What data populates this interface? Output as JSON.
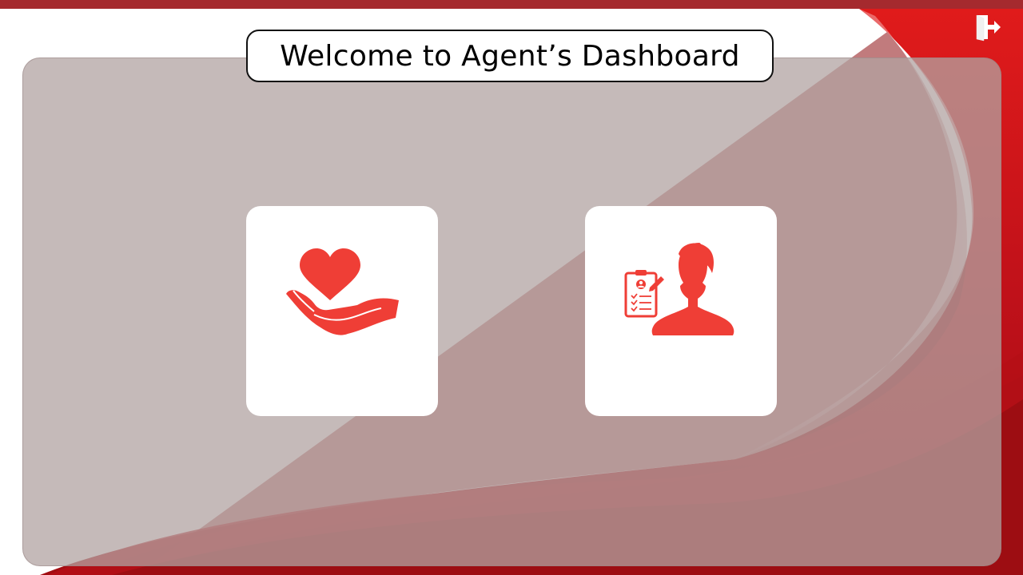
{
  "header": {
    "title": "Welcome to Agent’s Dashboard"
  },
  "toolbar": {
    "exit_icon": "door-exit-icon"
  },
  "cards": [
    {
      "icon": "hand-heart-icon"
    },
    {
      "icon": "agent-profile-clipboard-icon"
    }
  ],
  "colors": {
    "top_bar": "#a52a2e",
    "accent_red": "#c8101a",
    "dark_red": "#8e0f12",
    "icon_red": "#ef3e36",
    "panel_gray": "#c4bab8"
  }
}
